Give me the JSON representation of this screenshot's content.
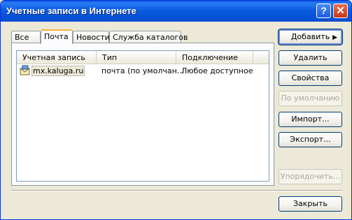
{
  "window": {
    "title": "Учетные записи в Интернете",
    "help_glyph": "?",
    "close_glyph": "✕"
  },
  "tabs": [
    {
      "label": "Все",
      "active": false
    },
    {
      "label": "Почта",
      "active": true
    },
    {
      "label": "Новости",
      "active": false
    },
    {
      "label": "Служба каталогов",
      "active": false
    }
  ],
  "list": {
    "columns": [
      "Учетная запись",
      "Тип",
      "Подключение"
    ],
    "rows": [
      {
        "account": "mx.kaluga.ru",
        "type": "почта (по умолчан...",
        "connection": "Любое доступное",
        "icon": "mail-account-icon"
      }
    ]
  },
  "buttons": {
    "add": "Добавить",
    "remove": "Удалить",
    "properties": "Свойства",
    "set_default": "По умолчанию",
    "import": "Импорт...",
    "export": "Экспорт...",
    "order": "Упорядочить...",
    "close": "Закрыть",
    "add_arrow": "▶"
  },
  "colors": {
    "titlebar": "#0a5ce6",
    "face": "#ece9d8",
    "tab_highlight": "#f8b13a"
  }
}
